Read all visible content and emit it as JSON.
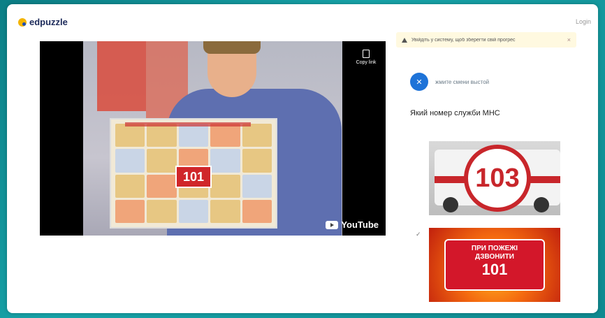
{
  "app": {
    "logo_text": "edpuzzle",
    "login_link": "Login"
  },
  "video": {
    "copy_link_label": "Copy link",
    "youtube_label": "YouTube",
    "poster_number": "101"
  },
  "notice": {
    "text": "Увійдіть у систему, щоб зберегти свій прогрес",
    "close": "×"
  },
  "sidebar": {
    "avatar_initial": "✕",
    "mark_text": "жмите смени выстой",
    "question": "Який номер служби МНС"
  },
  "answers": [
    {
      "number_text": "103"
    },
    {
      "line1": "ПРИ ПОЖЕЖІ",
      "line2": "ДЗВОНИТИ",
      "number_text": "101",
      "check": "✓"
    }
  ]
}
